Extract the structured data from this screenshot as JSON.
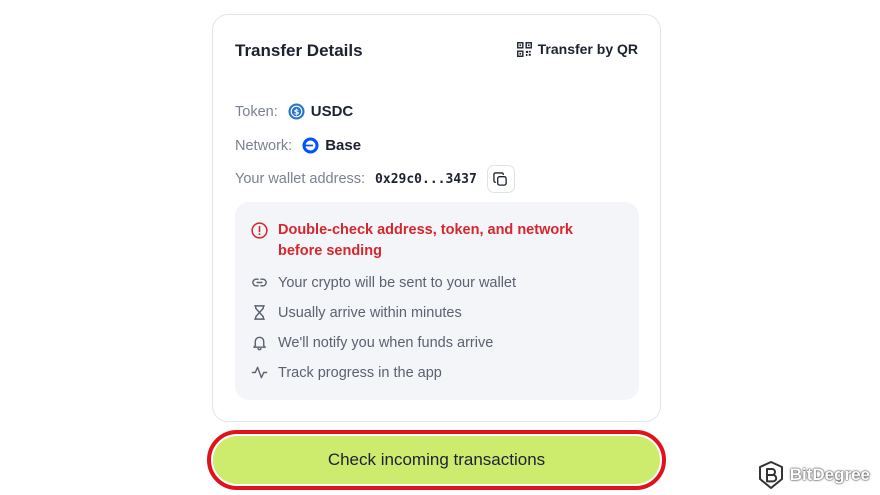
{
  "card": {
    "title": "Transfer Details",
    "qr_label": "Transfer by QR",
    "token_label": "Token:",
    "token_value": "USDC",
    "network_label": "Network:",
    "network_value": "Base",
    "wallet_label": "Your wallet address:",
    "wallet_value": "0x29c0...3437"
  },
  "notice": {
    "warning": "Double-check address, token, and network before sending",
    "items": [
      {
        "icon": "link-icon",
        "text": "Your crypto will be sent to your wallet"
      },
      {
        "icon": "hourglass-icon",
        "text": "Usually arrive within minutes"
      },
      {
        "icon": "bell-icon",
        "text": "We'll notify you when funds arrive"
      },
      {
        "icon": "activity-icon",
        "text": "Track progress in the app"
      }
    ]
  },
  "cta": {
    "label": "Check incoming transactions"
  },
  "watermark": {
    "text": "BitDegree"
  },
  "colors": {
    "warning": "#d6262e",
    "cta_bg": "#cdeb6c",
    "highlight_ring": "#e0121b",
    "usdc": "#2775ca",
    "base": "#0052ff"
  }
}
